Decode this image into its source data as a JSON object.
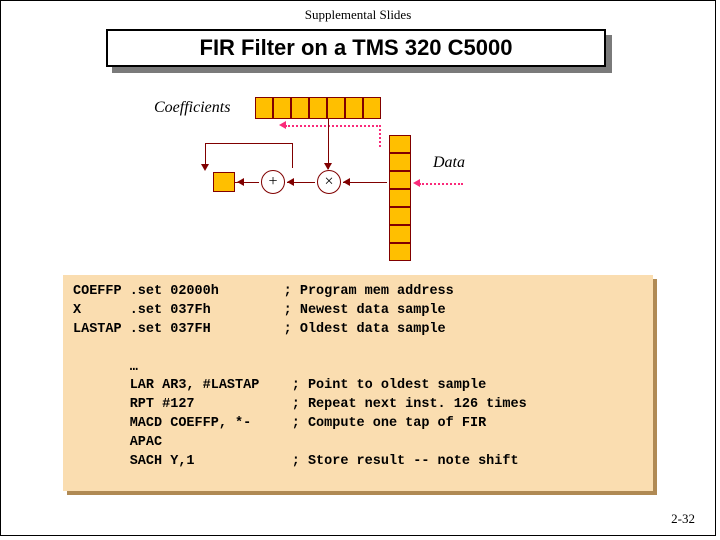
{
  "header": "Supplemental Slides",
  "title": "FIR Filter on a TMS 320 C5000",
  "labels": {
    "coefficients": "Coefficients",
    "data": "Data"
  },
  "ops": {
    "add": "+",
    "mul": "×"
  },
  "code": "COEFFP .set 02000h        ; Program mem address\nX      .set 037Fh         ; Newest data sample\nLASTAP .set 037FH         ; Oldest data sample\n\n       …\n       LAR AR3, #LASTAP    ; Point to oldest sample\n       RPT #127            ; Repeat next inst. 126 times\n       MACD COEFFP, *-     ; Compute one tap of FIR\n       APAC\n       SACH Y,1            ; Store result -- note shift",
  "slide_number": "2-32",
  "diagram": {
    "coeff_cells": 7,
    "data_cells": 7
  }
}
